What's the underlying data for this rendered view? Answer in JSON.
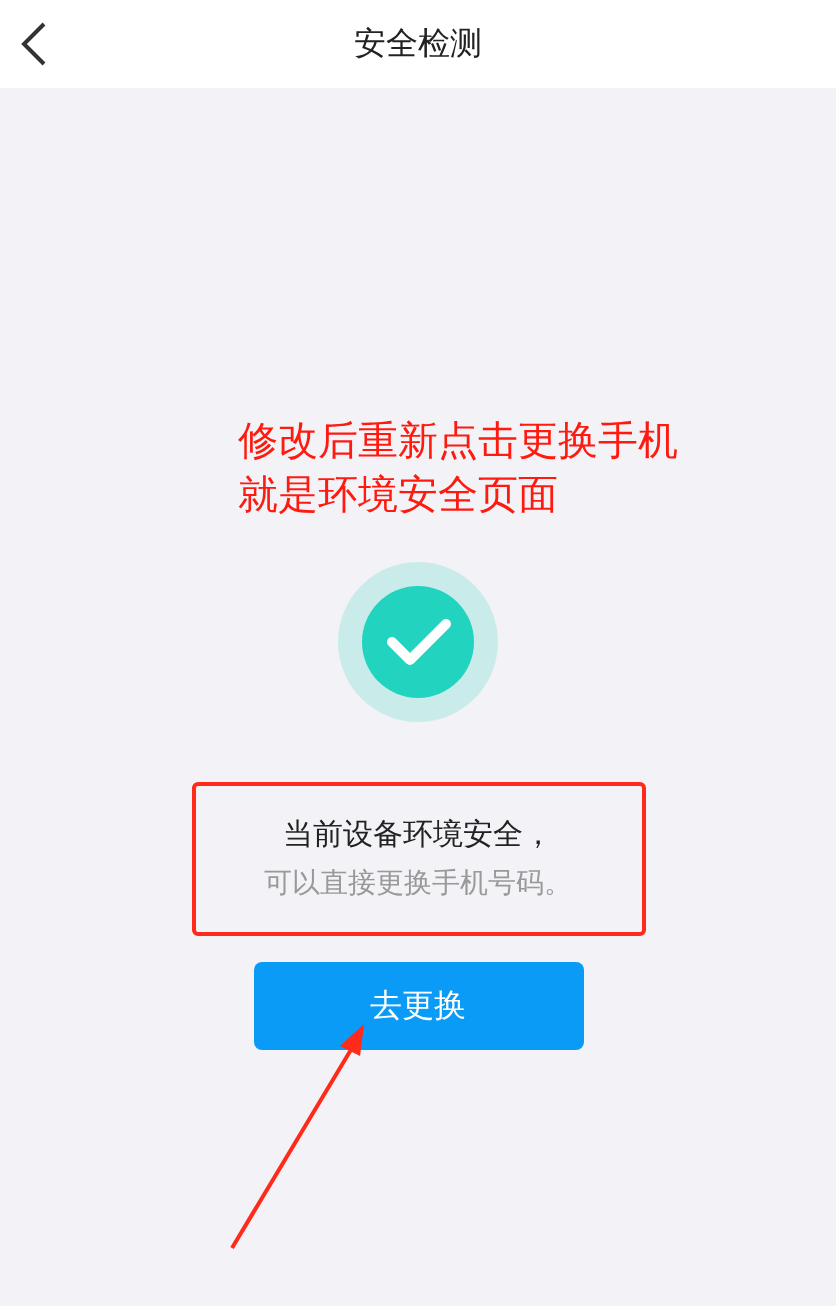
{
  "header": {
    "title": "安全检测"
  },
  "annotation": {
    "lines": [
      "修改后重新点击更换手机",
      "就是环境安全页面"
    ]
  },
  "result": {
    "safe": true,
    "message": "当前设备环境安全，",
    "hint": "可以直接更换手机号码。"
  },
  "button": {
    "label": "去更换"
  }
}
